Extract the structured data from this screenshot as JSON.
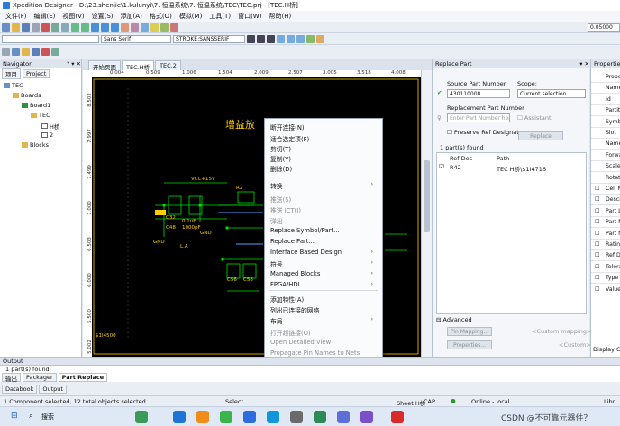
{
  "window": {
    "title": "Xpedition Designer - D:\\23.shenjie\\1.kulunyi\\7. 恒温系统\\7. 恒温系统\\TEC\\TEC.prj - [TEC.H桥]"
  },
  "menu": [
    "文件(F)",
    "编辑(E)",
    "视图(V)",
    "设置(S)",
    "添加(A)",
    "格式(O)",
    "模拟(M)",
    "工具(T)",
    "窗口(W)",
    "帮助(H)"
  ],
  "toolbar": {
    "font": "Sans Serif",
    "stroke": "STROKE:SANSSERIF",
    "zoom": "0.05000"
  },
  "navigator": {
    "title": "Navigator",
    "tabs": [
      "项目",
      "Project"
    ],
    "tree": [
      "TEC",
      "Boards",
      "Board1",
      "TEC",
      "H桥",
      "2",
      "Blocks"
    ]
  },
  "doc_tabs": [
    "开始页面",
    "TEC.H桥",
    "TEC.2"
  ],
  "ruler": {
    "top": [
      "0.004",
      "0.509",
      "1.006",
      "1.504",
      "2.009",
      "2.507",
      "3.005",
      "3.518",
      "4.008"
    ],
    "left": [
      "8.502",
      "7.997",
      "7.499",
      "7.000",
      "6.503",
      "6.000",
      "5.500",
      "5.002"
    ]
  },
  "schematic": {
    "title": "增益放",
    "labels": [
      "VCC+15V",
      "R2",
      "C32",
      "C48",
      "GND",
      "GND",
      "L.A",
      "C56",
      "C58",
      "0.1uF",
      "1000pF",
      "$1I4500"
    ]
  },
  "context_menu": {
    "items": [
      {
        "label": "断开连接(N)",
        "disabled": false,
        "submenu": false
      },
      {
        "label": "适合选定项(F)",
        "disabled": false,
        "submenu": false
      },
      {
        "label": "剪切(T)",
        "disabled": false,
        "submenu": false
      },
      {
        "label": "复制(Y)",
        "disabled": false,
        "submenu": false
      },
      {
        "label": "删除(D)",
        "disabled": false,
        "submenu": false
      },
      {
        "label": "转换",
        "disabled": false,
        "submenu": true
      },
      {
        "label": "推送(S)",
        "disabled": true,
        "submenu": false
      },
      {
        "label": "推送 ICT(I)",
        "disabled": true,
        "submenu": false
      },
      {
        "label": "弹出",
        "disabled": true,
        "submenu": false
      },
      {
        "label": "Replace Symbol/Part...",
        "disabled": false,
        "submenu": false
      },
      {
        "label": "Replace Part...",
        "disabled": false,
        "submenu": false
      },
      {
        "label": "Interface Based Design",
        "disabled": false,
        "submenu": true
      },
      {
        "label": "符号",
        "disabled": false,
        "submenu": true
      },
      {
        "label": "Managed Blocks",
        "disabled": false,
        "submenu": true
      },
      {
        "label": "FPGA/HDL",
        "disabled": false,
        "submenu": true
      },
      {
        "label": "添加特性(A)",
        "disabled": false,
        "submenu": false
      },
      {
        "label": "列出已连接的网络",
        "disabled": false,
        "submenu": false
      },
      {
        "label": "布局",
        "disabled": false,
        "submenu": true
      },
      {
        "label": "打开超链接(O)",
        "disabled": true,
        "submenu": false
      },
      {
        "label": "Open Detailed View",
        "disabled": true,
        "submenu": false
      },
      {
        "label": "Propagate Pin Names to Nets",
        "disabled": true,
        "submenu": false
      },
      {
        "label": "Load into Search",
        "disabled": false,
        "submenu": false
      },
      {
        "label": "特性(P)",
        "disabled": false,
        "submenu": false
      },
      {
        "label": "载入 Databook(L)",
        "disabled": true,
        "submenu": false
      }
    ]
  },
  "replace_part": {
    "title": "Replace Part",
    "source_label": "Source Part Number",
    "source_value": "430110008",
    "scope_label": "Scope:",
    "scope_value": "Current selection",
    "replacement_label": "Replacement Part Number",
    "replacement_placeholder": "Enter Part Number here",
    "assistant": "Assistant",
    "preserve": "Preserve Ref Designator",
    "replace_btn": "Replace",
    "found": "1 part(s) found",
    "col_ref": "Ref Des",
    "col_path": "Path",
    "row_ref": "R42",
    "row_path": "TEC H桥\\$1I4716",
    "advanced": "Advanced",
    "pin_mapping": "Pin Mapping...",
    "custom_mapping": "<Custom mapping>",
    "properties": "Properties...",
    "custom": "<Custom>"
  },
  "properties": {
    "title": "Properties",
    "rows": [
      "Prope",
      "Name",
      "Id",
      "Partiti",
      "Symb",
      "Slot",
      "Name",
      "Forwa",
      "Scale",
      "Rotat",
      "Cell N",
      "Descr",
      "Part L",
      "Part N",
      "Part N",
      "Ratin",
      "Ref D",
      "Tolera",
      "Type",
      "Value"
    ],
    "footer": "Display C"
  },
  "output": {
    "title": "Output",
    "tabs": [
      "输出",
      "Packager",
      "Part Replace"
    ],
    "line": "1 part(s) found",
    "sub_tabs": [
      "Databook",
      "Output"
    ],
    "status": "1 Component selected, 12 total objects selected"
  },
  "statusbar": {
    "mode": "Select",
    "sheet": "Sheet H桥",
    "cap": "CAP",
    "online": "Online - local",
    "libr": "Libr"
  },
  "taskbar": {
    "search": "搜索",
    "watermark": "CSDN @不可靠元器件？"
  },
  "colors": {
    "canvas": "#000000",
    "wire": "#00e000",
    "component": "#ffcc00",
    "net": "#4fa0ff"
  }
}
